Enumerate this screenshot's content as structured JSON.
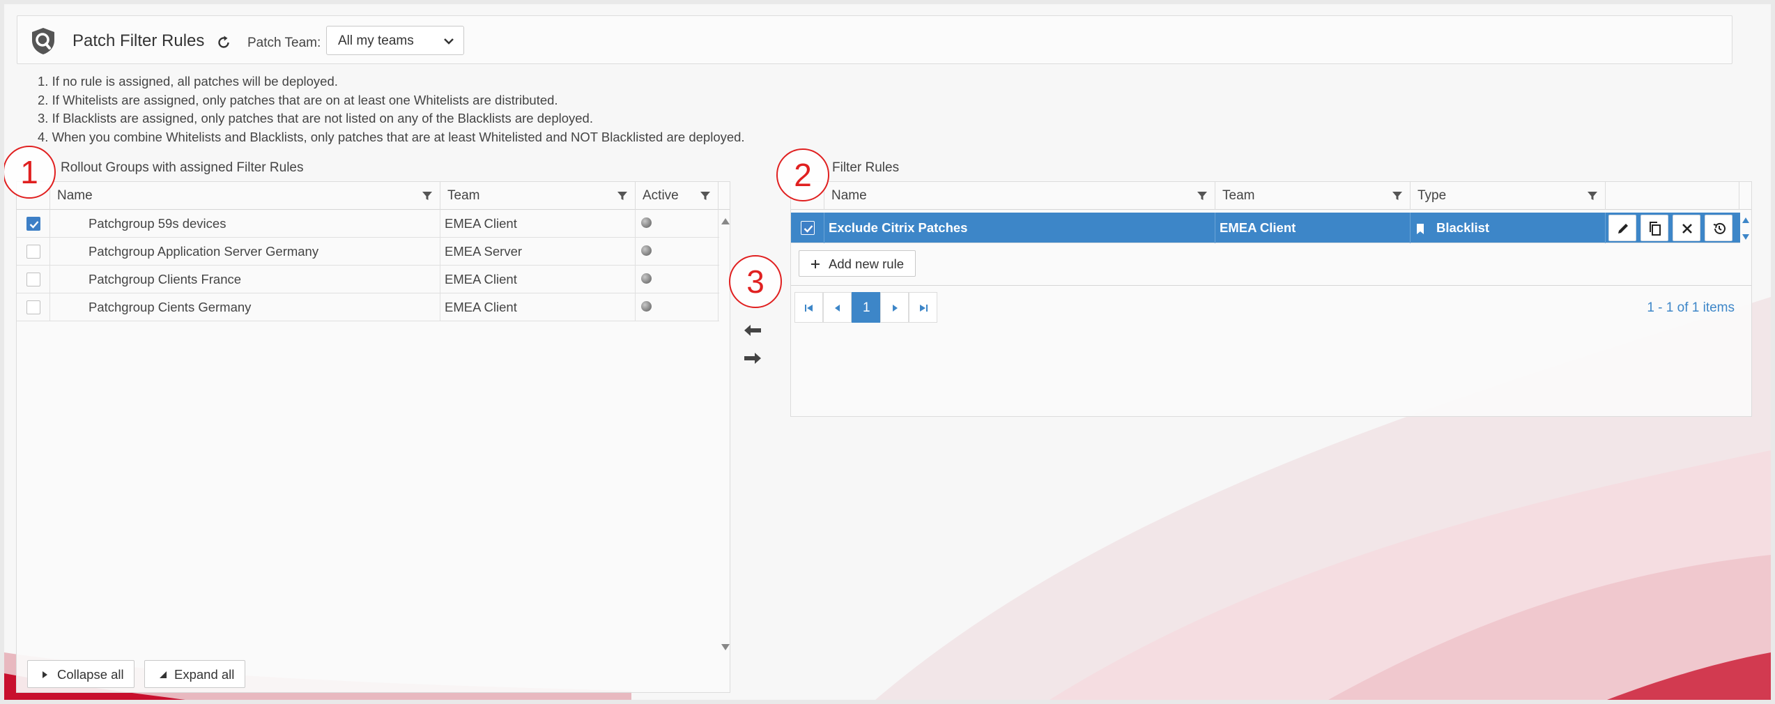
{
  "header": {
    "title": "Patch Filter Rules",
    "team_label": "Patch Team:",
    "team_value": "All my teams"
  },
  "notes": [
    "1. If no rule is assigned, all patches will be deployed.",
    "2. If Whitelists are assigned, only patches that are on at least one Whitelists are distributed.",
    "3. If Blacklists are assigned, only patches that are not listed on any of the Blacklists are deployed.",
    "4. When you combine Whitelists and Blacklists, only patches that are at least Whitelisted and NOT Blacklisted are deployed."
  ],
  "left_panel": {
    "title": "Rollout Groups with assigned Filter Rules",
    "columns": {
      "name": "Name",
      "team": "Team",
      "active": "Active"
    },
    "rows": [
      {
        "name": "Patchgroup 59s devices",
        "team": "EMEA Client",
        "checked": true
      },
      {
        "name": "Patchgroup Application Server Germany",
        "team": "EMEA Server",
        "checked": false
      },
      {
        "name": "Patchgroup Clients France",
        "team": "EMEA Client",
        "checked": false
      },
      {
        "name": "Patchgroup Cients Germany",
        "team": "EMEA Client",
        "checked": false
      }
    ],
    "collapse_label": "Collapse all",
    "expand_label": "Expand all"
  },
  "right_panel": {
    "title": "Filter Rules",
    "columns": {
      "name": "Name",
      "team": "Team",
      "type": "Type"
    },
    "rows": [
      {
        "name": "Exclude Citrix Patches",
        "team": "EMEA Client",
        "type": "Blacklist",
        "checked": true
      }
    ],
    "add_label": "Add new rule",
    "pager": {
      "current_page": "1",
      "summary": "1 - 1 of 1 items"
    }
  },
  "callouts": [
    "1",
    "2",
    "3"
  ],
  "colors": {
    "accent": "#3d86c8",
    "callout": "#e02020",
    "brand_bg": "#c8102e"
  }
}
